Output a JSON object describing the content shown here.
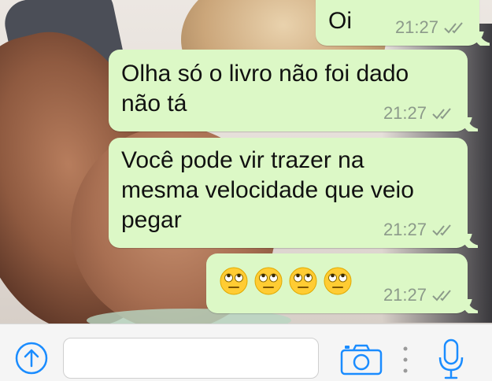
{
  "chat": {
    "messages": [
      {
        "text": "Oi",
        "time": "21:27",
        "status": "read-double-check"
      },
      {
        "text": "Olha só o livro não foi dado\nnão tá",
        "time": "21:27",
        "status": "read-double-check"
      },
      {
        "text": "Você pode vir trazer na\nmesma velocidade que veio\npegar",
        "time": "21:27",
        "status": "read-double-check"
      },
      {
        "emojis": [
          "face-with-rolling-eyes",
          "face-with-rolling-eyes",
          "face-with-rolling-eyes",
          "face-with-rolling-eyes"
        ],
        "time": "21:27",
        "status": "read-double-check"
      }
    ]
  },
  "composer": {
    "input_value": "",
    "placeholder": "",
    "icons": [
      "upload-arrow-icon",
      "camera-icon",
      "more-dots-icon",
      "microphone-icon"
    ]
  },
  "colors": {
    "outgoing_bubble": "#dcf8c6",
    "accent_blue": "#1a8cff",
    "tick_gray": "#8c9a8a",
    "composer_bg": "#f5f5f5"
  }
}
